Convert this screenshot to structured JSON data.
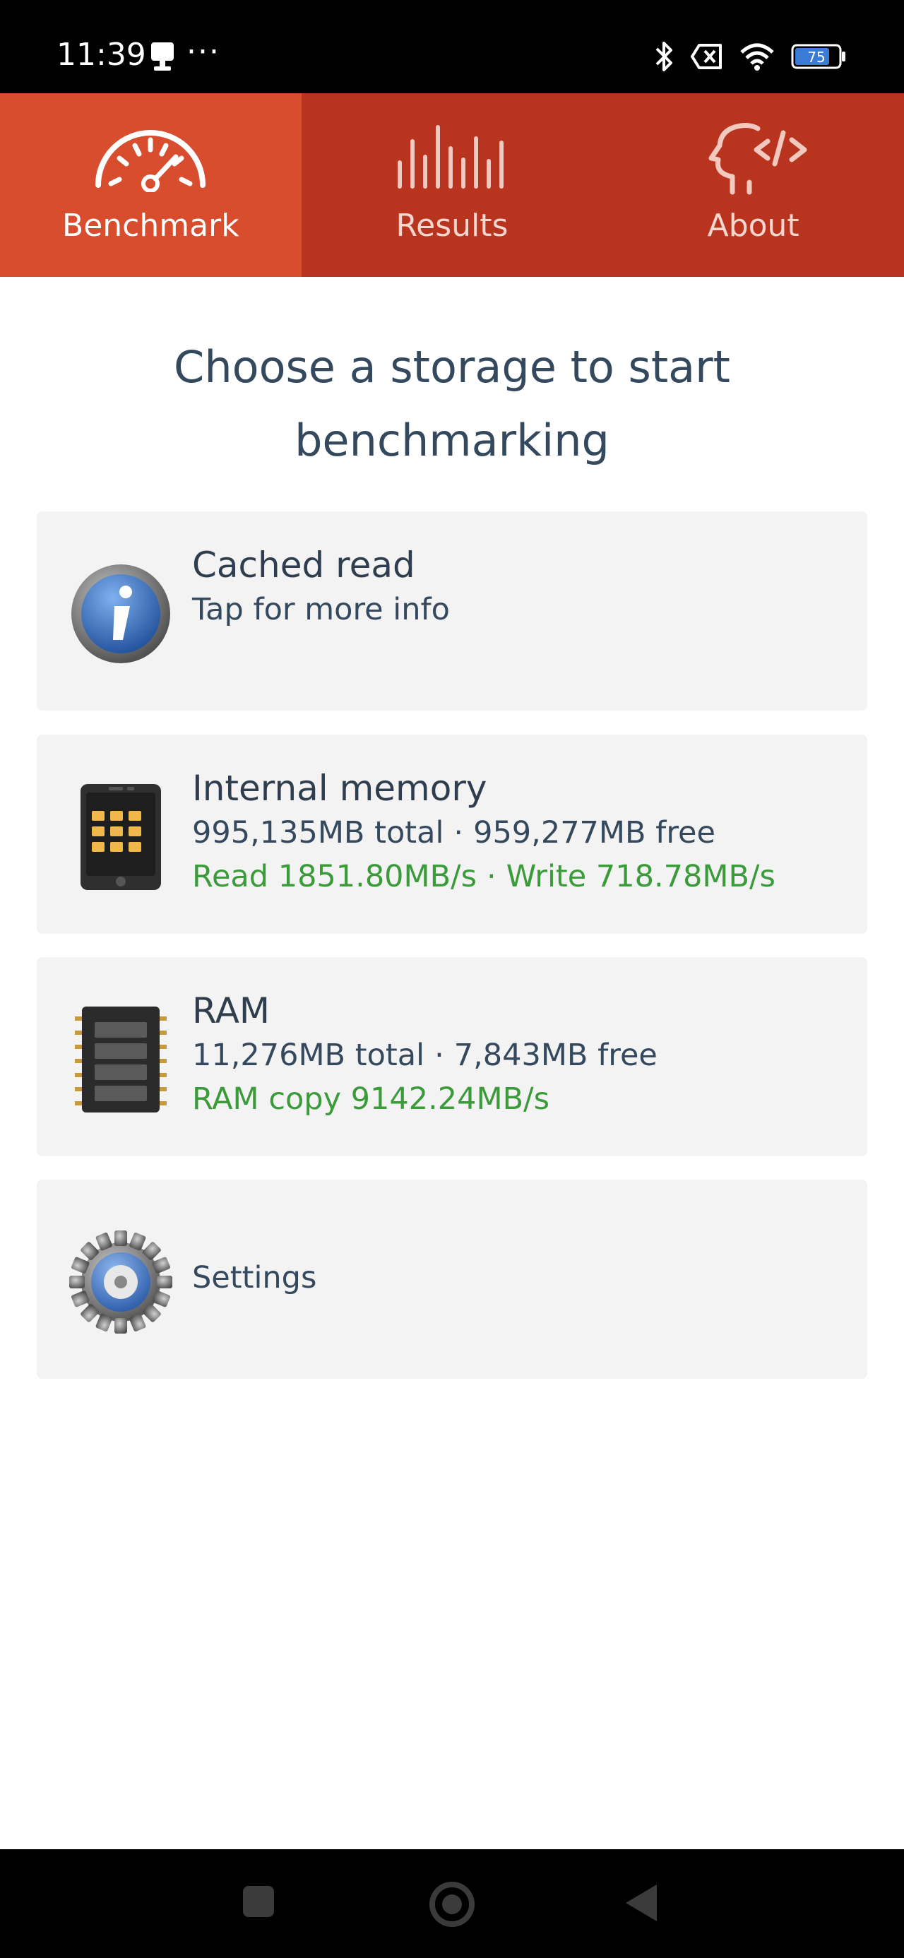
{
  "status_bar": {
    "time": "11:39",
    "dots": "···",
    "battery_level": "75"
  },
  "tabs": [
    {
      "label": "Benchmark",
      "icon": "speedometer-icon",
      "active": true
    },
    {
      "label": "Results",
      "icon": "bars-icon",
      "active": false
    },
    {
      "label": "About",
      "icon": "head-code-icon",
      "active": false
    }
  ],
  "heading": "Choose a storage to start benchmarking",
  "cards": {
    "cached": {
      "title": "Cached read",
      "subtitle": "Tap for more info",
      "icon": "info-icon"
    },
    "internal": {
      "title": "Internal memory",
      "total": "995,135MB total",
      "free": "959,277MB free",
      "read": "Read 1851.80MB/s",
      "write": "Write 718.78MB/s",
      "separator": "·",
      "icon": "phone-icon"
    },
    "ram": {
      "title": "RAM",
      "total": "11,276MB total",
      "free": "7,843MB free",
      "copy": "RAM copy 9142.24MB/s",
      "separator": "·",
      "icon": "ram-chip-icon"
    },
    "settings": {
      "title": "Settings",
      "icon": "gear-icon"
    }
  },
  "colors": {
    "tab_active": "#d84d2e",
    "tab_inactive": "#b8341f",
    "heading_text": "#34495e",
    "speed_green": "#3b9a3a",
    "card_bg": "#f3f3f3"
  }
}
